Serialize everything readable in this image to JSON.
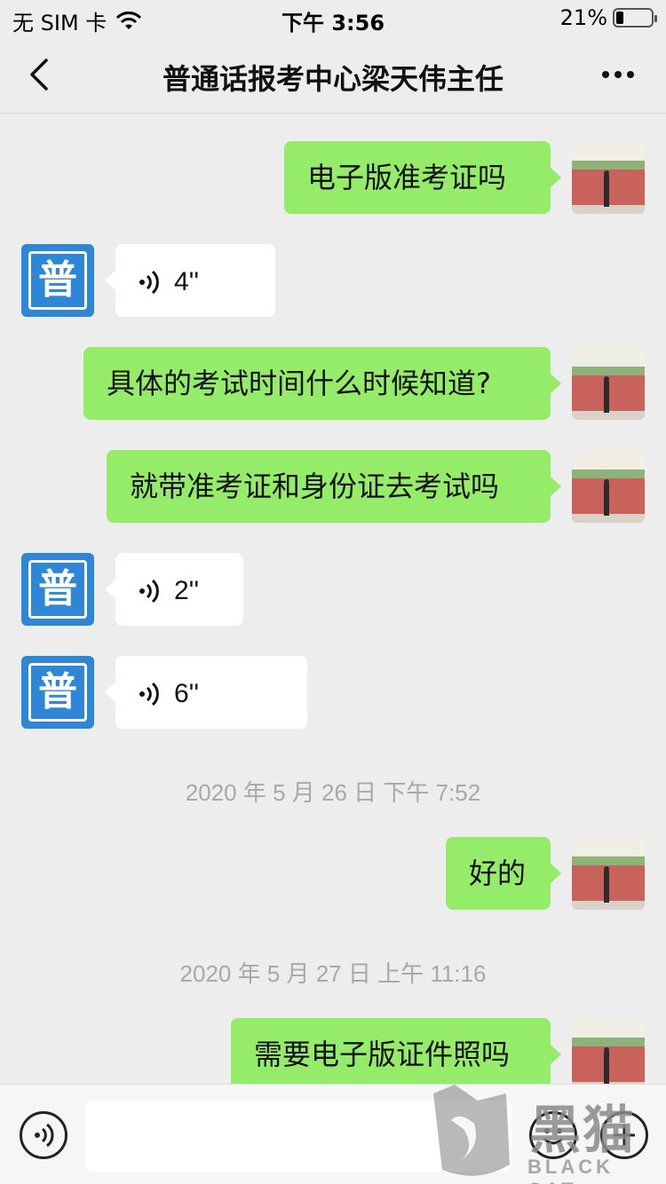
{
  "status_bar": {
    "carrier": "无 SIM 卡",
    "time": "下午 3:56",
    "battery_percent": "21%",
    "battery_level": 0.21
  },
  "nav": {
    "title": "普通话报考中心梁天伟主任"
  },
  "contact_avatar_char": "普",
  "messages": [
    {
      "from": "self",
      "type": "text",
      "text": "电子版准考证吗"
    },
    {
      "from": "other",
      "type": "voice",
      "duration": "4''"
    },
    {
      "from": "self",
      "type": "text",
      "text": "具体的考试时间什么时候知道?"
    },
    {
      "from": "self",
      "type": "text",
      "text": "就带准考证和身份证去考试吗"
    },
    {
      "from": "other",
      "type": "voice",
      "duration": "2''"
    },
    {
      "from": "other",
      "type": "voice",
      "duration": "6''"
    },
    {
      "type": "timestamp",
      "text": "2020 年 5 月 26 日 下午 7:52"
    },
    {
      "from": "self",
      "type": "text",
      "text": "好的"
    },
    {
      "type": "timestamp",
      "text": "2020 年 5 月 27 日 上午 11:16"
    },
    {
      "from": "self",
      "type": "text",
      "text": "需要电子版证件照吗"
    }
  ],
  "input": {
    "value": "",
    "placeholder": ""
  },
  "watermark": {
    "cn": "黑猫",
    "en": "BLACK CAT"
  },
  "colors": {
    "self_bubble": "#95ec69",
    "other_bubble": "#ffffff",
    "background": "#ededed",
    "contact_avatar": "#2d86d6"
  }
}
